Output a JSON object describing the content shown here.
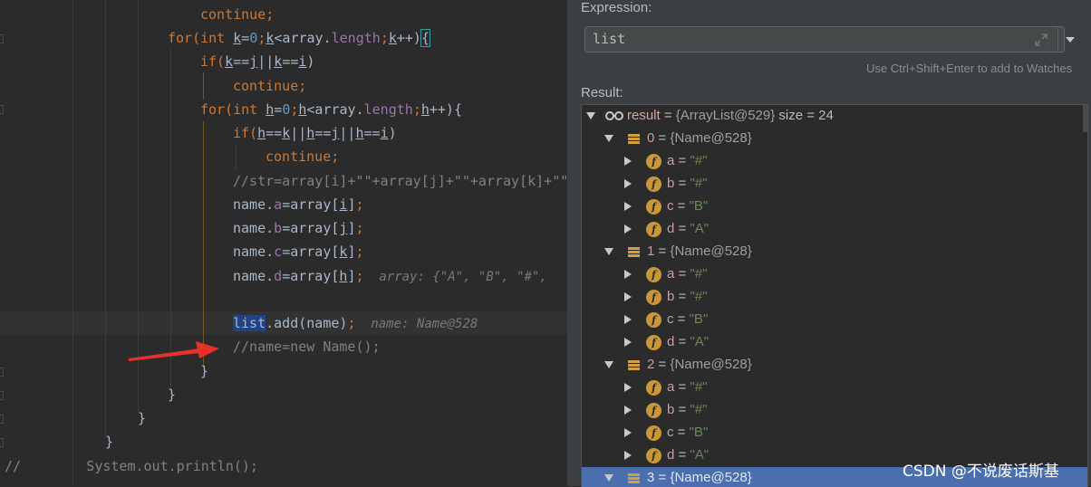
{
  "editor": {
    "lines": [
      {
        "segments": [
          {
            "t": "continue;",
            "c": "kw"
          }
        ]
      },
      {
        "segments": [
          {
            "t": "for(",
            "c": "kw"
          },
          {
            "t": "int ",
            "c": "kw"
          },
          {
            "t": "k",
            "c": "ul"
          },
          {
            "t": "="
          },
          {
            "t": "0",
            "c": "num"
          },
          {
            "t": ";",
            "c": "kw"
          },
          {
            "t": "k",
            "c": "ul"
          },
          {
            "t": "<array."
          },
          {
            "t": "length",
            "c": "fld"
          },
          {
            "t": ";",
            "c": "kw"
          },
          {
            "t": "k",
            "c": "ul"
          },
          {
            "t": "++)"
          },
          {
            "t": "{",
            "c": "caret-br"
          }
        ]
      },
      {
        "segments": [
          {
            "t": "if(",
            "c": "kw"
          },
          {
            "t": "k",
            "c": "ul"
          },
          {
            "t": "=="
          },
          {
            "t": "j",
            "c": "ul"
          },
          {
            "t": "||"
          },
          {
            "t": "k",
            "c": "ul"
          },
          {
            "t": "=="
          },
          {
            "t": "i",
            "c": "ul"
          },
          {
            "t": ")"
          }
        ]
      },
      {
        "segments": [
          {
            "t": "continue;",
            "c": "kw"
          }
        ]
      },
      {
        "segments": [
          {
            "t": "for(",
            "c": "kw"
          },
          {
            "t": "int ",
            "c": "kw"
          },
          {
            "t": "h",
            "c": "ul"
          },
          {
            "t": "="
          },
          {
            "t": "0",
            "c": "num"
          },
          {
            "t": ";",
            "c": "kw"
          },
          {
            "t": "h",
            "c": "ul"
          },
          {
            "t": "<array."
          },
          {
            "t": "length",
            "c": "fld"
          },
          {
            "t": ";",
            "c": "kw"
          },
          {
            "t": "h",
            "c": "ul"
          },
          {
            "t": "++){"
          }
        ]
      },
      {
        "segments": [
          {
            "t": "if(",
            "c": "kw"
          },
          {
            "t": "h",
            "c": "ul"
          },
          {
            "t": "=="
          },
          {
            "t": "k",
            "c": "ul"
          },
          {
            "t": "||"
          },
          {
            "t": "h",
            "c": "ul"
          },
          {
            "t": "=="
          },
          {
            "t": "j",
            "c": "ul"
          },
          {
            "t": "||"
          },
          {
            "t": "h",
            "c": "ul"
          },
          {
            "t": "=="
          },
          {
            "t": "i",
            "c": "ul"
          },
          {
            "t": ")"
          }
        ]
      },
      {
        "segments": [
          {
            "t": "continue;",
            "c": "kw"
          }
        ]
      },
      {
        "segments": [
          {
            "t": "//str=array[i]+\"\"+array[j]+\"\"+array[k]+\"\"",
            "c": "cmt"
          }
        ]
      },
      {
        "segments": [
          {
            "t": "name."
          },
          {
            "t": "a",
            "c": "fld"
          },
          {
            "t": "=array["
          },
          {
            "t": "i",
            "c": "ul"
          },
          {
            "t": "]"
          },
          {
            "t": ";",
            "c": "kw"
          }
        ]
      },
      {
        "segments": [
          {
            "t": "name."
          },
          {
            "t": "b",
            "c": "fld"
          },
          {
            "t": "=array["
          },
          {
            "t": "j",
            "c": "ul"
          },
          {
            "t": "]"
          },
          {
            "t": ";",
            "c": "kw"
          }
        ]
      },
      {
        "segments": [
          {
            "t": "name."
          },
          {
            "t": "c",
            "c": "fld"
          },
          {
            "t": "=array["
          },
          {
            "t": "k",
            "c": "ul"
          },
          {
            "t": "]"
          },
          {
            "t": ";",
            "c": "kw"
          }
        ]
      },
      {
        "segments": [
          {
            "t": "name."
          },
          {
            "t": "d",
            "c": "fld"
          },
          {
            "t": "=array["
          },
          {
            "t": "h",
            "c": "ul"
          },
          {
            "t": "]"
          },
          {
            "t": ";",
            "c": "kw"
          },
          {
            "t": "  array: {\"A\", \"B\", \"#\",",
            "c": "hint"
          }
        ]
      },
      {
        "segments": []
      },
      {
        "segments": [
          {
            "t": "list",
            "c": "sel"
          },
          {
            "t": ".add(name)"
          },
          {
            "t": ";",
            "c": "kw"
          },
          {
            "t": "  name: Name@528",
            "c": "hint"
          }
        ]
      },
      {
        "segments": [
          {
            "t": "//name=new Name();",
            "c": "cmt"
          }
        ]
      },
      {
        "segments": [
          {
            "t": "}"
          }
        ]
      },
      {
        "segments": [
          {
            "t": "}"
          }
        ]
      },
      {
        "segments": [
          {
            "t": "}"
          }
        ]
      },
      {
        "segments": [
          {
            "t": "}"
          }
        ]
      },
      {
        "segments": [
          {
            "t": "//        System.out.println();",
            "c": "cmt"
          }
        ]
      }
    ]
  },
  "debugger": {
    "expression_label": "Expression:",
    "expression_value": "list",
    "watch_hint": "Use Ctrl+Shift+Enter to add to Watches",
    "result_label": "Result:",
    "tree": [
      {
        "level": 0,
        "kind": "watch",
        "name": "result",
        "eq": " = ",
        "type": "{ArrayList@529}",
        "extra": "  size = 24",
        "open": true
      },
      {
        "level": 1,
        "kind": "list",
        "name": "0",
        "eq": " = ",
        "type": "{Name@528}",
        "open": true
      },
      {
        "level": 2,
        "kind": "field",
        "name": "a",
        "eq": " = ",
        "str": "\"#\"",
        "open": false
      },
      {
        "level": 2,
        "kind": "field",
        "name": "b",
        "eq": " = ",
        "str": "\"#\"",
        "open": false
      },
      {
        "level": 2,
        "kind": "field",
        "name": "c",
        "eq": " = ",
        "str": "\"B\"",
        "open": false
      },
      {
        "level": 2,
        "kind": "field",
        "name": "d",
        "eq": " = ",
        "str": "\"A\"",
        "open": false
      },
      {
        "level": 1,
        "kind": "list",
        "name": "1",
        "eq": " = ",
        "type": "{Name@528}",
        "open": true
      },
      {
        "level": 2,
        "kind": "field",
        "name": "a",
        "eq": " = ",
        "str": "\"#\"",
        "open": false
      },
      {
        "level": 2,
        "kind": "field",
        "name": "b",
        "eq": " = ",
        "str": "\"#\"",
        "open": false
      },
      {
        "level": 2,
        "kind": "field",
        "name": "c",
        "eq": " = ",
        "str": "\"B\"",
        "open": false
      },
      {
        "level": 2,
        "kind": "field",
        "name": "d",
        "eq": " = ",
        "str": "\"A\"",
        "open": false
      },
      {
        "level": 1,
        "kind": "list",
        "name": "2",
        "eq": " = ",
        "type": "{Name@528}",
        "open": true
      },
      {
        "level": 2,
        "kind": "field",
        "name": "a",
        "eq": " = ",
        "str": "\"#\"",
        "open": false
      },
      {
        "level": 2,
        "kind": "field",
        "name": "b",
        "eq": " = ",
        "str": "\"#\"",
        "open": false
      },
      {
        "level": 2,
        "kind": "field",
        "name": "c",
        "eq": " = ",
        "str": "\"B\"",
        "open": false
      },
      {
        "level": 2,
        "kind": "field",
        "name": "d",
        "eq": " = ",
        "str": "\"A\"",
        "open": false
      },
      {
        "level": 1,
        "kind": "list",
        "name": "3",
        "eq": " = ",
        "type": "{Name@528}",
        "open": true,
        "selected": true
      }
    ]
  },
  "watermark": "CSDN @不说废话斯基",
  "colors": {
    "keyword": "#cc7832",
    "field": "#9876aa",
    "number": "#6897bb",
    "string": "#6a8759",
    "comment": "#808080",
    "selection": "#4b6eaf",
    "arrow": "#e8302a"
  }
}
